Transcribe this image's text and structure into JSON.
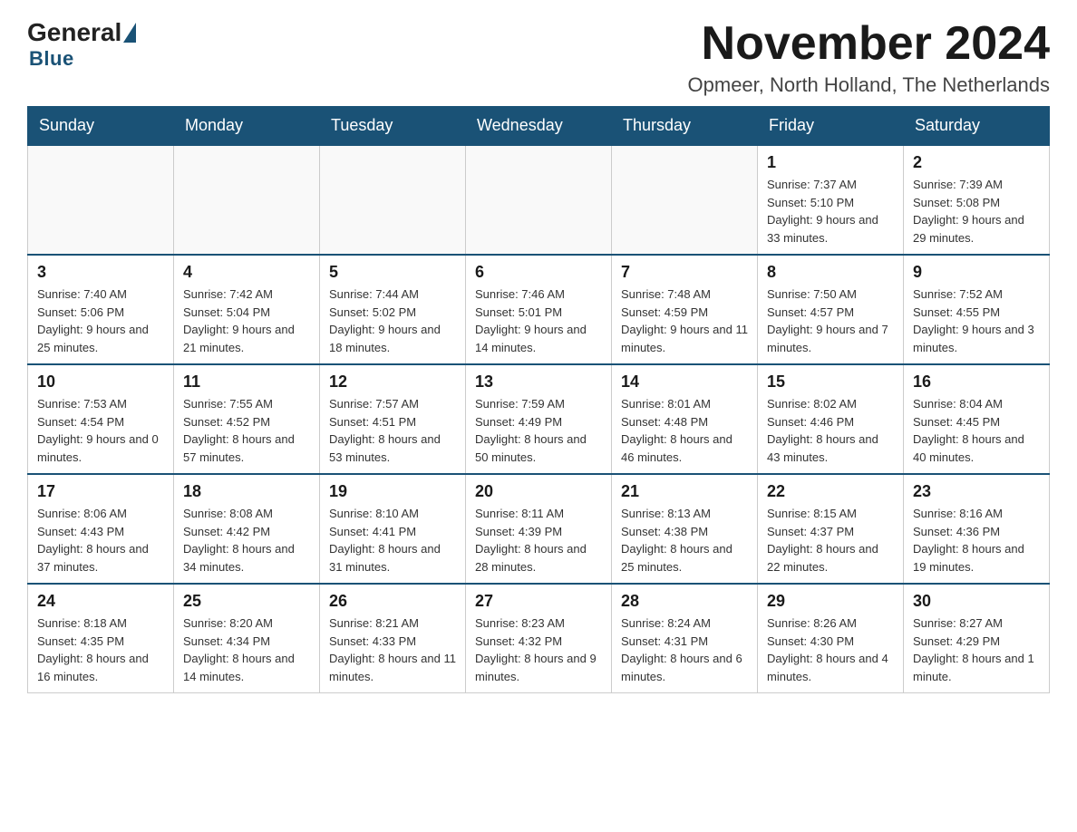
{
  "logo": {
    "general": "General",
    "blue": "Blue"
  },
  "header": {
    "month": "November 2024",
    "location": "Opmeer, North Holland, The Netherlands"
  },
  "weekdays": [
    "Sunday",
    "Monday",
    "Tuesday",
    "Wednesday",
    "Thursday",
    "Friday",
    "Saturday"
  ],
  "weeks": [
    [
      {
        "day": "",
        "info": ""
      },
      {
        "day": "",
        "info": ""
      },
      {
        "day": "",
        "info": ""
      },
      {
        "day": "",
        "info": ""
      },
      {
        "day": "",
        "info": ""
      },
      {
        "day": "1",
        "info": "Sunrise: 7:37 AM\nSunset: 5:10 PM\nDaylight: 9 hours and 33 minutes."
      },
      {
        "day": "2",
        "info": "Sunrise: 7:39 AM\nSunset: 5:08 PM\nDaylight: 9 hours and 29 minutes."
      }
    ],
    [
      {
        "day": "3",
        "info": "Sunrise: 7:40 AM\nSunset: 5:06 PM\nDaylight: 9 hours and 25 minutes."
      },
      {
        "day": "4",
        "info": "Sunrise: 7:42 AM\nSunset: 5:04 PM\nDaylight: 9 hours and 21 minutes."
      },
      {
        "day": "5",
        "info": "Sunrise: 7:44 AM\nSunset: 5:02 PM\nDaylight: 9 hours and 18 minutes."
      },
      {
        "day": "6",
        "info": "Sunrise: 7:46 AM\nSunset: 5:01 PM\nDaylight: 9 hours and 14 minutes."
      },
      {
        "day": "7",
        "info": "Sunrise: 7:48 AM\nSunset: 4:59 PM\nDaylight: 9 hours and 11 minutes."
      },
      {
        "day": "8",
        "info": "Sunrise: 7:50 AM\nSunset: 4:57 PM\nDaylight: 9 hours and 7 minutes."
      },
      {
        "day": "9",
        "info": "Sunrise: 7:52 AM\nSunset: 4:55 PM\nDaylight: 9 hours and 3 minutes."
      }
    ],
    [
      {
        "day": "10",
        "info": "Sunrise: 7:53 AM\nSunset: 4:54 PM\nDaylight: 9 hours and 0 minutes."
      },
      {
        "day": "11",
        "info": "Sunrise: 7:55 AM\nSunset: 4:52 PM\nDaylight: 8 hours and 57 minutes."
      },
      {
        "day": "12",
        "info": "Sunrise: 7:57 AM\nSunset: 4:51 PM\nDaylight: 8 hours and 53 minutes."
      },
      {
        "day": "13",
        "info": "Sunrise: 7:59 AM\nSunset: 4:49 PM\nDaylight: 8 hours and 50 minutes."
      },
      {
        "day": "14",
        "info": "Sunrise: 8:01 AM\nSunset: 4:48 PM\nDaylight: 8 hours and 46 minutes."
      },
      {
        "day": "15",
        "info": "Sunrise: 8:02 AM\nSunset: 4:46 PM\nDaylight: 8 hours and 43 minutes."
      },
      {
        "day": "16",
        "info": "Sunrise: 8:04 AM\nSunset: 4:45 PM\nDaylight: 8 hours and 40 minutes."
      }
    ],
    [
      {
        "day": "17",
        "info": "Sunrise: 8:06 AM\nSunset: 4:43 PM\nDaylight: 8 hours and 37 minutes."
      },
      {
        "day": "18",
        "info": "Sunrise: 8:08 AM\nSunset: 4:42 PM\nDaylight: 8 hours and 34 minutes."
      },
      {
        "day": "19",
        "info": "Sunrise: 8:10 AM\nSunset: 4:41 PM\nDaylight: 8 hours and 31 minutes."
      },
      {
        "day": "20",
        "info": "Sunrise: 8:11 AM\nSunset: 4:39 PM\nDaylight: 8 hours and 28 minutes."
      },
      {
        "day": "21",
        "info": "Sunrise: 8:13 AM\nSunset: 4:38 PM\nDaylight: 8 hours and 25 minutes."
      },
      {
        "day": "22",
        "info": "Sunrise: 8:15 AM\nSunset: 4:37 PM\nDaylight: 8 hours and 22 minutes."
      },
      {
        "day": "23",
        "info": "Sunrise: 8:16 AM\nSunset: 4:36 PM\nDaylight: 8 hours and 19 minutes."
      }
    ],
    [
      {
        "day": "24",
        "info": "Sunrise: 8:18 AM\nSunset: 4:35 PM\nDaylight: 8 hours and 16 minutes."
      },
      {
        "day": "25",
        "info": "Sunrise: 8:20 AM\nSunset: 4:34 PM\nDaylight: 8 hours and 14 minutes."
      },
      {
        "day": "26",
        "info": "Sunrise: 8:21 AM\nSunset: 4:33 PM\nDaylight: 8 hours and 11 minutes."
      },
      {
        "day": "27",
        "info": "Sunrise: 8:23 AM\nSunset: 4:32 PM\nDaylight: 8 hours and 9 minutes."
      },
      {
        "day": "28",
        "info": "Sunrise: 8:24 AM\nSunset: 4:31 PM\nDaylight: 8 hours and 6 minutes."
      },
      {
        "day": "29",
        "info": "Sunrise: 8:26 AM\nSunset: 4:30 PM\nDaylight: 8 hours and 4 minutes."
      },
      {
        "day": "30",
        "info": "Sunrise: 8:27 AM\nSunset: 4:29 PM\nDaylight: 8 hours and 1 minute."
      }
    ]
  ]
}
